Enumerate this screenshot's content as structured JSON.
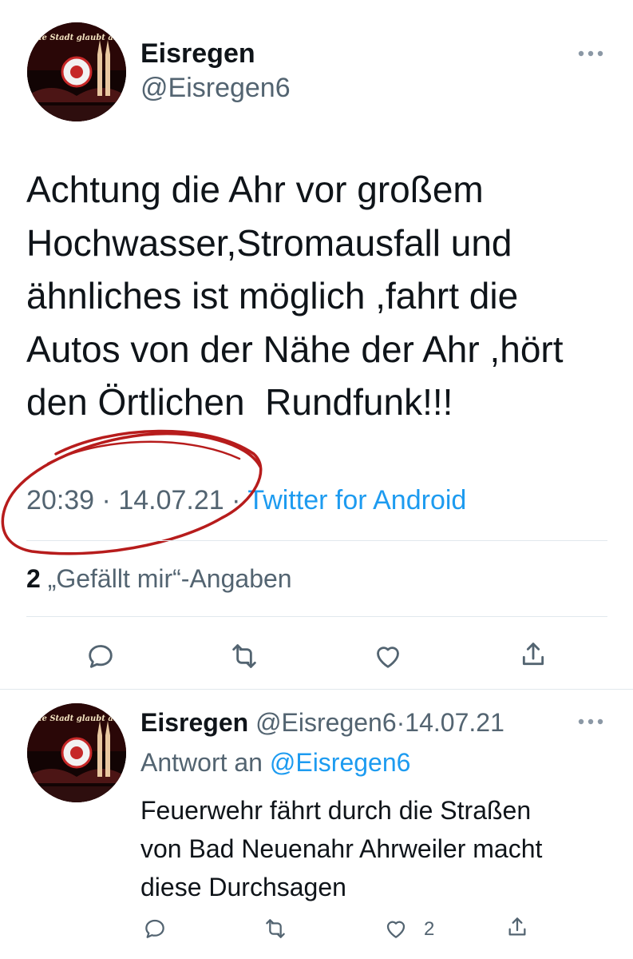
{
  "main_tweet": {
    "display_name": "Eisregen",
    "handle": "@Eisregen6",
    "avatar_text": "Die Stadt glaubt an Euch",
    "text_lines": [
      "Achtung die Ahr vor großem",
      "Hochwasser,Stromausfall und",
      "ähnliches ist möglich ,fahrt die",
      "Autos von der Nähe der Ahr ,hört",
      "den Örtlichen  Rundfunk!!!"
    ],
    "time": "20:39",
    "date": "14.07.21",
    "separator": "·",
    "source": "Twitter for Android",
    "likes_count": "2",
    "likes_label": "„Gefällt mir“-Angaben",
    "actions": [
      "reply-icon",
      "retweet-icon",
      "like-icon",
      "share-icon"
    ]
  },
  "reply_tweet": {
    "display_name": "Eisregen",
    "handle": "@Eisregen6",
    "separator": "·",
    "date": "14.07.21",
    "replying_prefix": "Antwort an",
    "replying_to": "@Eisregen6",
    "avatar_text": "Die Stadt glaubt an Euch",
    "text_lines": [
      "Feuerwehr fährt durch die Straßen",
      "von Bad Neuenahr Ahrweiler macht",
      "diese Durchsagen"
    ],
    "like_count": "2",
    "actions": [
      "reply-icon",
      "retweet-icon",
      "like-icon",
      "share-icon"
    ]
  },
  "colors": {
    "text": "#0f1419",
    "muted": "#536471",
    "link": "#1d9bf0",
    "divider": "#e1e8ed",
    "annotation": "#b71c1c"
  }
}
